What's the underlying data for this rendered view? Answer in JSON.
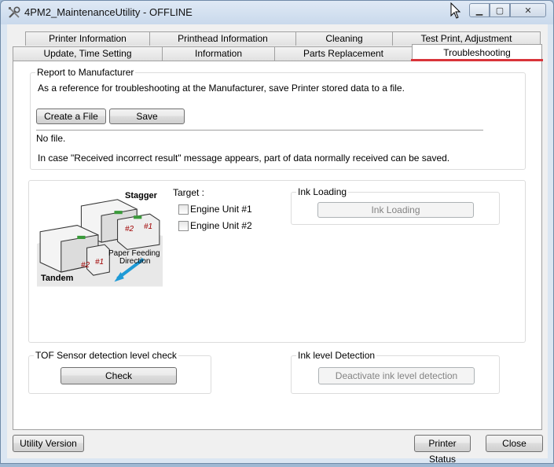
{
  "window": {
    "title": "4PM2_MaintenanceUtility - OFFLINE",
    "controls": {
      "minimize": "▁",
      "maximize": "▢",
      "close": "✕"
    }
  },
  "tabs": {
    "row_back": [
      "Printer Information",
      "Printhead Information",
      "Cleaning",
      "Test Print, Adjustment"
    ],
    "row_front": [
      "Update, Time Setting",
      "Information",
      "Parts Replacement",
      "Troubleshooting"
    ],
    "active": "Troubleshooting",
    "active_underline_color": "#d9343a"
  },
  "report": {
    "group_label": "Report to Manufacturer",
    "description": "As a reference for troubleshooting at the Manufacturer, save Printer stored data to a file.",
    "create_button": "Create a File",
    "save_button": "Save",
    "file_status": "No file.",
    "note": "In case \"Received incorrect result\" message appears, part of data normally received can be saved."
  },
  "illustration": {
    "stagger_label": "Stagger",
    "tandem_label": "Tandem",
    "unit1_label": "#1",
    "unit2_label": "#2",
    "paper_feed_label_line1": "Paper Feeding",
    "paper_feed_label_line2": "Direction"
  },
  "target": {
    "label": "Target :",
    "options": [
      {
        "label": "Engine Unit #1",
        "checked": false
      },
      {
        "label": "Engine Unit #2",
        "checked": false
      }
    ]
  },
  "ink_loading": {
    "group_label": "Ink Loading",
    "button": "Ink Loading"
  },
  "tof_sensor": {
    "group_label": "TOF Sensor detection level check",
    "button": "Check"
  },
  "ink_level": {
    "group_label": "Ink level Detection",
    "button": "Deactivate ink level detection"
  },
  "footer": {
    "utility_version_button": "Utility Version",
    "printer_status_button": "Printer Status",
    "close_button": "Close"
  }
}
